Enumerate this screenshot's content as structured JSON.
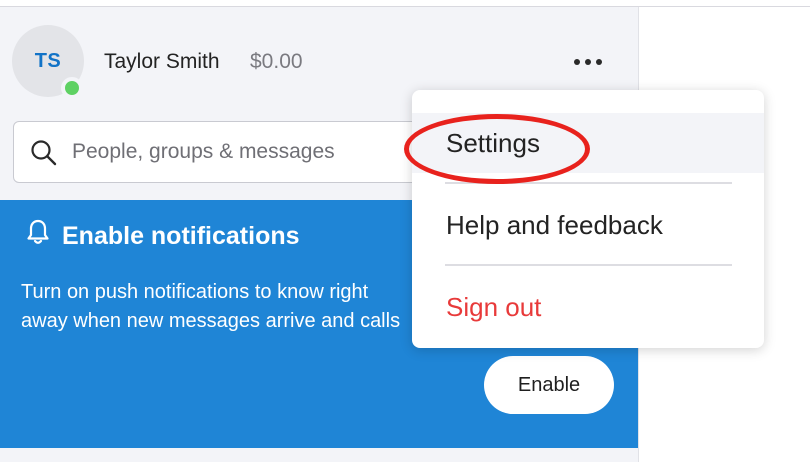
{
  "profile": {
    "initials": "TS",
    "name": "Taylor Smith",
    "credit": "$0.00",
    "status_color": "#5ed163"
  },
  "search": {
    "placeholder": "People, groups & messages",
    "value": ""
  },
  "banner": {
    "title": "Enable notifications",
    "body": "Turn on push notifications to know right away when new messages arrive and calls happen.",
    "button_label": "Enable",
    "background_color": "#1f85d6"
  },
  "menu": {
    "items": [
      {
        "label": "Settings"
      },
      {
        "label": "Help and feedback"
      },
      {
        "label": "Sign out"
      }
    ],
    "signout_color": "#e83a3a"
  },
  "icons": {
    "search": "search-icon",
    "bell": "bell-icon",
    "more": "more-options-icon"
  }
}
